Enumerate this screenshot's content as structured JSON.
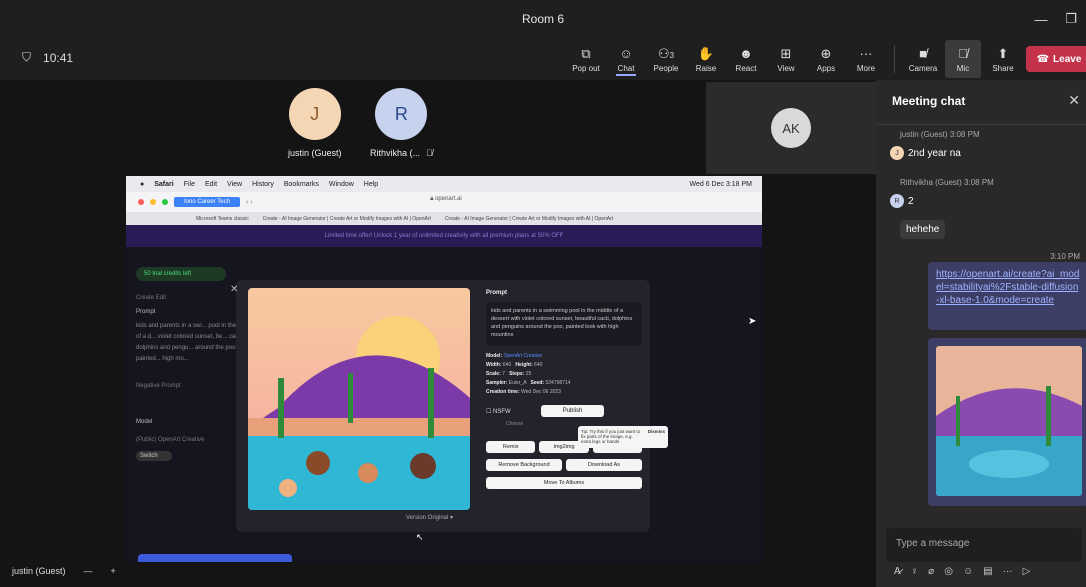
{
  "window": {
    "title": "Room 6",
    "minimize": "—",
    "restore": "❐"
  },
  "meeting": {
    "time": "10:41"
  },
  "toolbar": {
    "items": [
      {
        "icon": "⧉",
        "label": "Pop out"
      },
      {
        "icon": "☺",
        "label": "Chat"
      },
      {
        "icon": "⚇",
        "label": "People",
        "count": "3"
      },
      {
        "icon": "✋",
        "label": "Raise"
      },
      {
        "icon": "☻",
        "label": "React"
      },
      {
        "icon": "⊞",
        "label": "View"
      },
      {
        "icon": "⊕",
        "label": "Apps"
      },
      {
        "icon": "···",
        "label": "More"
      }
    ],
    "camera_label": "Camera",
    "mic_label": "Mic",
    "share_label": "Share",
    "leave_label": "Leave"
  },
  "participants": [
    {
      "initial": "J",
      "name": "justin (Guest)",
      "color": "#f5d6b4",
      "text_color": "#8a5a2b"
    },
    {
      "initial": "R",
      "name": "Rithvikha (...",
      "color": "#c7d3ee",
      "text_color": "#2b4a8a"
    }
  ],
  "ak_tile": {
    "initials": "AK"
  },
  "shared_screen": {
    "mac_menu": [
      "Safari",
      "File",
      "Edit",
      "View",
      "History",
      "Bookmarks",
      "Window",
      "Help"
    ],
    "mac_status": "Wed 6 Dec 3:18 PM",
    "browser_tab_blue": "Iono Career Tech",
    "url": "openart.ai",
    "tabs": [
      "Microsoft Teams classic",
      "Create - AI Image Generator | Create Art or Modify Images with AI | OpenArt",
      "Create - AI Image Generator | Create Art or Modify Images with AI | OpenArt"
    ],
    "promo": "Limited time offer! Unlock 1 year of unlimited creativity with all premium plans at 50% OFF",
    "side_pill": "50 trial credits left",
    "side_tabs": "Create    Edit",
    "side_prompt_label": "Prompt",
    "side_prompt_text": "kids and parents in a swi... pool in the middle of a d... violet colored sunset, be... cacti, dolphins and pengu... around the poo, painted... high mo...",
    "side_negative": "Negative Prompt",
    "side_model": "Model",
    "side_model_name": "(Public) OpenArt Creative",
    "side_switch": "Switch",
    "create_btn": "Create",
    "modal": {
      "prompt_title": "Prompt",
      "prompt_text": "kids and parents in a swimming pool in the middle of a dessert with violet colored sunset, beautiful cacti, dolphins and penguins around the poo, painted look with high mountins",
      "model_label": "Model:",
      "model_value": "OpenArt Creative",
      "width_label": "Width:",
      "width_value": "640",
      "height_label": "Height:",
      "height_value": "640",
      "scale_label": "Scale:",
      "scale_value": "7",
      "steps_label": "Steps:",
      "steps_value": "25",
      "sampler_label": "Sampler:",
      "sampler_value": "Euler_A",
      "seed_label": "Seed:",
      "seed_value": "524798714",
      "creation_label": "Creation time:",
      "creation_value": "Wed Dec 06 2023",
      "nsfw_label": "NSFW",
      "publish": "Publish",
      "tip": "Tip: Try this if you just want to fix parts of the image, e.g. extra legs or hands",
      "dismiss": "Dismiss",
      "choose": "Choose",
      "remix": "Remix",
      "img2img": "Img2img",
      "edit": "Edit",
      "remove_bg": "Remove Background",
      "download": "Download As",
      "move_albums": "Move To Albums",
      "version": "Version Original"
    }
  },
  "self_tile": {
    "name": "justin (Guest)"
  },
  "chat": {
    "title": "Meeting chat",
    "messages": [
      {
        "sender": "justin (Guest)",
        "time": "3:08 PM",
        "text": "2nd year na",
        "initial": "J",
        "color": "#f5d6b4"
      },
      {
        "sender": "Rithvikha (Guest)",
        "time": "3:08 PM",
        "text": "2",
        "initial": "R",
        "color": "#c7d3ee"
      },
      {
        "text": "hehehe"
      }
    ],
    "my_time": "3:10 PM",
    "my_link": "https://openart.ai/create?ai_model=stabilityai%2Fstable-diffusion-xl-base-1.0&mode=create",
    "compose_placeholder": "Type a message"
  }
}
